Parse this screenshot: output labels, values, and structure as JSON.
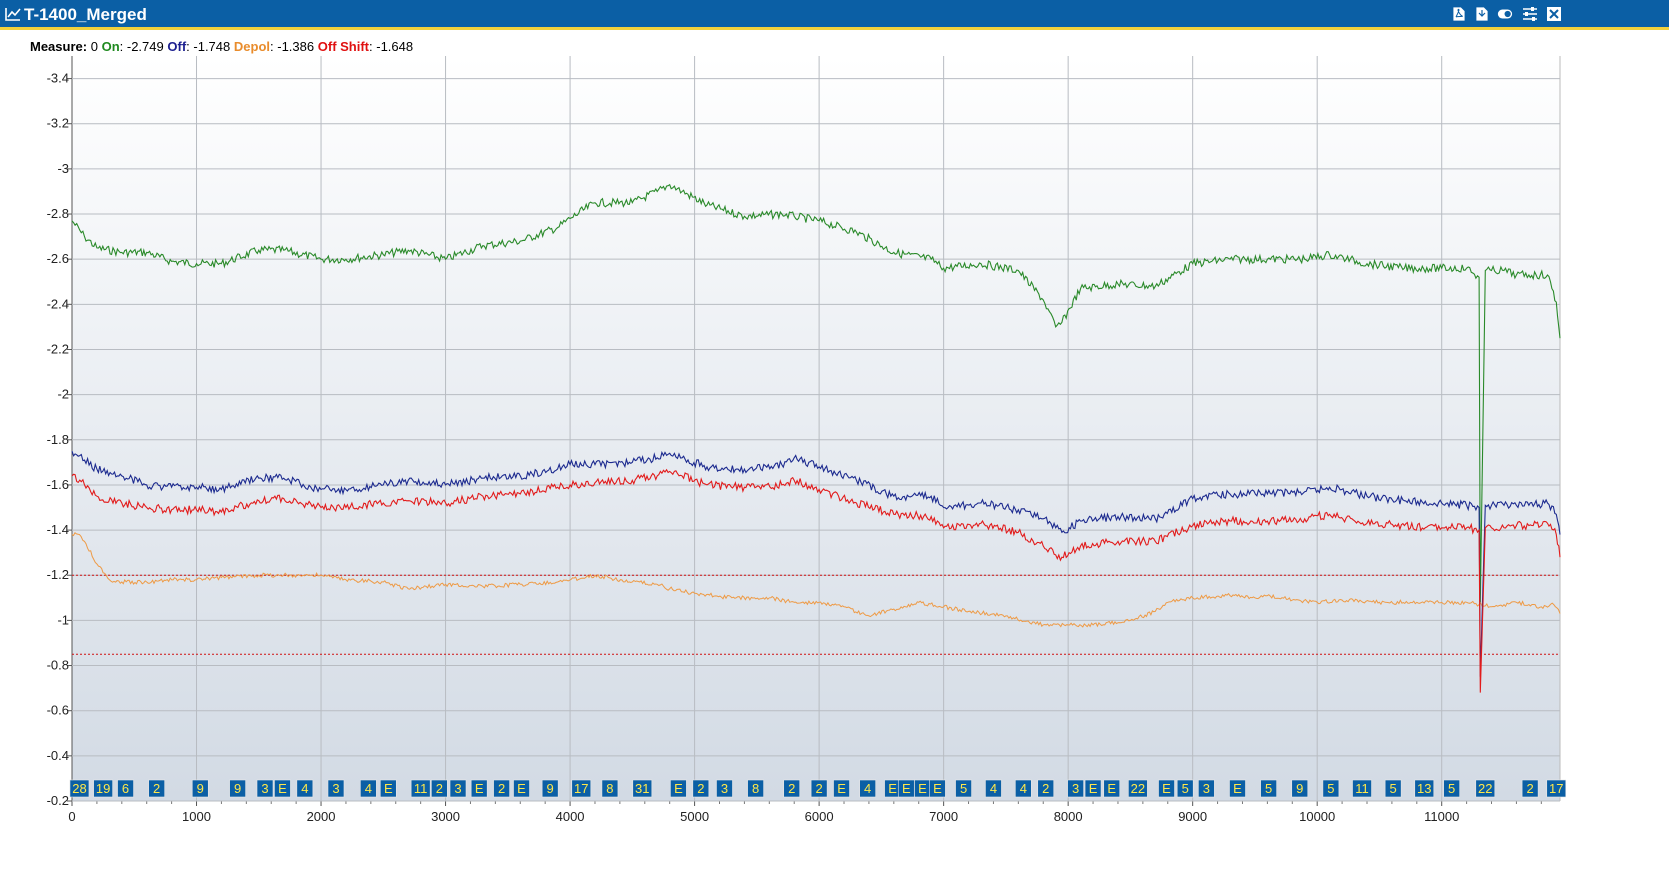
{
  "window": {
    "title": "T-1400_Merged",
    "icons": [
      "line-chart-icon",
      "pdf-export-icon",
      "file-export-icon",
      "toggle-icon",
      "settings-icon",
      "close-icon"
    ]
  },
  "measure": {
    "label": "Measure",
    "index": "0",
    "on_label": "On",
    "on_value": "-2.749",
    "off_label": "Off",
    "off_value": "-1.748",
    "depol_label": "Depol",
    "depol_value": "-1.386",
    "shift_label": "Off Shift",
    "shift_value": "-1.648"
  },
  "colors": {
    "on": "#2a8a2a",
    "off": "#1c2a8f",
    "depol": "#ee9a45",
    "shift": "#e21b1b",
    "titlebar": "#0b5fa5",
    "accent": "#f2d13c",
    "marker": "#0b5fa5"
  },
  "chart_data": {
    "type": "line",
    "x_ticks": [
      "0",
      "1000",
      "2000",
      "3000",
      "4000",
      "5000",
      "6000",
      "7000",
      "8000",
      "9000",
      "10000",
      "11000"
    ],
    "y_ticks": [
      "-0.2",
      "-0.4",
      "-0.6",
      "-0.8",
      "-1",
      "-1.2",
      "-1.4",
      "-1.6",
      "-1.8",
      "-2",
      "-2.2",
      "-2.4",
      "-2.6",
      "-2.8",
      "-3",
      "-3.2",
      "-3.4"
    ],
    "xlim": [
      0,
      11950
    ],
    "ylim": [
      -0.2,
      -3.5
    ],
    "y_inverted": true,
    "grid": true,
    "thresholds": [
      -1.2,
      -0.85
    ],
    "series": [
      {
        "name": "On",
        "key": "on",
        "x": [
          0,
          100,
          200,
          400,
          600,
          800,
          1000,
          1200,
          1500,
          1700,
          2000,
          2200,
          2500,
          2700,
          3000,
          3300,
          3600,
          3900,
          4000,
          4200,
          4500,
          4700,
          4800,
          4900,
          5100,
          5400,
          5700,
          5800,
          6000,
          6300,
          6600,
          6900,
          7000,
          7300,
          7600,
          7800,
          7900,
          7950,
          8100,
          8400,
          8700,
          9000,
          9300,
          9600,
          9900,
          10100,
          10400,
          10700,
          11000,
          11200,
          11300,
          11310,
          11350,
          11400,
          11500,
          11600,
          11700,
          11850,
          11920,
          11950
        ],
        "y": [
          -2.77,
          -2.7,
          -2.65,
          -2.63,
          -2.63,
          -2.59,
          -2.58,
          -2.58,
          -2.64,
          -2.64,
          -2.6,
          -2.6,
          -2.62,
          -2.64,
          -2.6,
          -2.66,
          -2.68,
          -2.74,
          -2.78,
          -2.85,
          -2.85,
          -2.9,
          -2.93,
          -2.9,
          -2.84,
          -2.79,
          -2.8,
          -2.79,
          -2.77,
          -2.72,
          -2.63,
          -2.6,
          -2.56,
          -2.58,
          -2.55,
          -2.42,
          -2.3,
          -2.32,
          -2.47,
          -2.49,
          -2.48,
          -2.58,
          -2.6,
          -2.6,
          -2.6,
          -2.62,
          -2.58,
          -2.56,
          -2.56,
          -2.56,
          -2.52,
          -1.08,
          -2.55,
          -2.55,
          -2.55,
          -2.53,
          -2.53,
          -2.53,
          -2.41,
          -2.25
        ]
      },
      {
        "name": "Off",
        "key": "off",
        "x": [
          0,
          100,
          200,
          400,
          600,
          800,
          1000,
          1200,
          1500,
          1700,
          2000,
          2200,
          2500,
          2700,
          3000,
          3300,
          3600,
          3900,
          4000,
          4200,
          4500,
          4700,
          4800,
          4900,
          5100,
          5400,
          5700,
          5800,
          6000,
          6300,
          6600,
          6900,
          7000,
          7300,
          7600,
          7800,
          7900,
          7950,
          8100,
          8400,
          8700,
          9000,
          9300,
          9600,
          9900,
          10100,
          10400,
          10700,
          11000,
          11200,
          11300,
          11310,
          11350,
          11400,
          11500,
          11600,
          11700,
          11850,
          11920,
          11950
        ],
        "y": [
          -1.75,
          -1.71,
          -1.67,
          -1.64,
          -1.6,
          -1.59,
          -1.59,
          -1.58,
          -1.63,
          -1.63,
          -1.58,
          -1.58,
          -1.6,
          -1.62,
          -1.6,
          -1.63,
          -1.64,
          -1.67,
          -1.69,
          -1.69,
          -1.7,
          -1.72,
          -1.74,
          -1.72,
          -1.68,
          -1.67,
          -1.69,
          -1.72,
          -1.68,
          -1.62,
          -1.55,
          -1.55,
          -1.5,
          -1.52,
          -1.49,
          -1.45,
          -1.41,
          -1.39,
          -1.44,
          -1.46,
          -1.45,
          -1.54,
          -1.56,
          -1.56,
          -1.57,
          -1.59,
          -1.55,
          -1.53,
          -1.52,
          -1.51,
          -1.5,
          -0.75,
          -1.51,
          -1.51,
          -1.51,
          -1.51,
          -1.51,
          -1.52,
          -1.47,
          -1.38
        ]
      },
      {
        "name": "Off Shift",
        "key": "shift",
        "x": [
          0,
          100,
          200,
          400,
          600,
          800,
          1000,
          1200,
          1500,
          1700,
          2000,
          2200,
          2500,
          2700,
          3000,
          3300,
          3600,
          3900,
          4000,
          4200,
          4500,
          4700,
          4800,
          4900,
          5100,
          5400,
          5700,
          5800,
          6000,
          6300,
          6600,
          6900,
          7000,
          7300,
          7600,
          7800,
          7900,
          7950,
          8100,
          8400,
          8700,
          9000,
          9300,
          9600,
          9900,
          10100,
          10400,
          10700,
          11000,
          11200,
          11300,
          11310,
          11350,
          11400,
          11500,
          11600,
          11700,
          11850,
          11920,
          11950
        ],
        "y": [
          -1.64,
          -1.6,
          -1.55,
          -1.52,
          -1.5,
          -1.49,
          -1.49,
          -1.48,
          -1.53,
          -1.54,
          -1.5,
          -1.5,
          -1.52,
          -1.53,
          -1.52,
          -1.55,
          -1.56,
          -1.59,
          -1.6,
          -1.61,
          -1.62,
          -1.64,
          -1.66,
          -1.64,
          -1.6,
          -1.59,
          -1.6,
          -1.62,
          -1.58,
          -1.52,
          -1.47,
          -1.46,
          -1.41,
          -1.43,
          -1.39,
          -1.33,
          -1.29,
          -1.28,
          -1.33,
          -1.35,
          -1.35,
          -1.42,
          -1.44,
          -1.44,
          -1.45,
          -1.47,
          -1.43,
          -1.42,
          -1.41,
          -1.41,
          -1.4,
          -0.68,
          -1.41,
          -1.41,
          -1.41,
          -1.42,
          -1.42,
          -1.43,
          -1.38,
          -1.28
        ]
      },
      {
        "name": "Depol",
        "key": "depol",
        "x": [
          0,
          60,
          100,
          200,
          300,
          400,
          600,
          800,
          1000,
          1200,
          1500,
          1700,
          2000,
          2200,
          2500,
          2700,
          3000,
          3300,
          3600,
          3900,
          4200,
          4500,
          4700,
          4800,
          5000,
          5300,
          5600,
          5800,
          6000,
          6200,
          6400,
          6600,
          6800,
          7000,
          7200,
          7500,
          7800,
          8000,
          8200,
          8400,
          8500,
          8700,
          8800,
          9000,
          9300,
          9500,
          9600,
          9800,
          10000,
          10200,
          10500,
          10800,
          11000,
          11200,
          11300,
          11400,
          11500,
          11600,
          11700,
          11800,
          11900,
          11950
        ],
        "y": [
          -1.38,
          -1.38,
          -1.35,
          -1.25,
          -1.18,
          -1.17,
          -1.17,
          -1.18,
          -1.18,
          -1.19,
          -1.2,
          -1.2,
          -1.2,
          -1.18,
          -1.17,
          -1.14,
          -1.16,
          -1.15,
          -1.16,
          -1.17,
          -1.2,
          -1.17,
          -1.16,
          -1.14,
          -1.12,
          -1.1,
          -1.1,
          -1.08,
          -1.08,
          -1.06,
          -1.02,
          -1.05,
          -1.08,
          -1.06,
          -1.04,
          -1.02,
          -0.98,
          -0.98,
          -0.98,
          -0.99,
          -1.0,
          -1.04,
          -1.08,
          -1.1,
          -1.11,
          -1.1,
          -1.11,
          -1.09,
          -1.08,
          -1.09,
          -1.08,
          -1.08,
          -1.08,
          -1.08,
          -1.07,
          -1.06,
          -1.07,
          -1.08,
          -1.07,
          -1.06,
          -1.07,
          -1.03
        ]
      }
    ],
    "markers": [
      {
        "x": 60,
        "label": "28"
      },
      {
        "x": 250,
        "label": "19"
      },
      {
        "x": 430,
        "label": "6"
      },
      {
        "x": 680,
        "label": "2"
      },
      {
        "x": 1030,
        "label": "9"
      },
      {
        "x": 1330,
        "label": "9"
      },
      {
        "x": 1550,
        "label": "3"
      },
      {
        "x": 1690,
        "label": "E"
      },
      {
        "x": 1870,
        "label": "4"
      },
      {
        "x": 2120,
        "label": "3"
      },
      {
        "x": 2380,
        "label": "4"
      },
      {
        "x": 2540,
        "label": "E"
      },
      {
        "x": 2800,
        "label": "11"
      },
      {
        "x": 2950,
        "label": "2"
      },
      {
        "x": 3100,
        "label": "3"
      },
      {
        "x": 3270,
        "label": "E"
      },
      {
        "x": 3450,
        "label": "2"
      },
      {
        "x": 3610,
        "label": "E"
      },
      {
        "x": 3840,
        "label": "9"
      },
      {
        "x": 4090,
        "label": "17"
      },
      {
        "x": 4320,
        "label": "8"
      },
      {
        "x": 4580,
        "label": "31"
      },
      {
        "x": 4870,
        "label": "E"
      },
      {
        "x": 5050,
        "label": "2"
      },
      {
        "x": 5240,
        "label": "3"
      },
      {
        "x": 5490,
        "label": "8"
      },
      {
        "x": 5780,
        "label": "2"
      },
      {
        "x": 6000,
        "label": "2"
      },
      {
        "x": 6180,
        "label": "E"
      },
      {
        "x": 6390,
        "label": "4"
      },
      {
        "x": 6590,
        "label": "E"
      },
      {
        "x": 6700,
        "label": "E"
      },
      {
        "x": 6830,
        "label": "E"
      },
      {
        "x": 6950,
        "label": "E"
      },
      {
        "x": 7160,
        "label": "5"
      },
      {
        "x": 7400,
        "label": "4"
      },
      {
        "x": 7640,
        "label": "4"
      },
      {
        "x": 7820,
        "label": "2"
      },
      {
        "x": 8060,
        "label": "3"
      },
      {
        "x": 8200,
        "label": "E"
      },
      {
        "x": 8350,
        "label": "E"
      },
      {
        "x": 8560,
        "label": "22"
      },
      {
        "x": 8790,
        "label": "E"
      },
      {
        "x": 8940,
        "label": "5"
      },
      {
        "x": 9110,
        "label": "3"
      },
      {
        "x": 9360,
        "label": "E"
      },
      {
        "x": 9610,
        "label": "5"
      },
      {
        "x": 9860,
        "label": "9"
      },
      {
        "x": 10110,
        "label": "5"
      },
      {
        "x": 10360,
        "label": "11"
      },
      {
        "x": 10610,
        "label": "5"
      },
      {
        "x": 10860,
        "label": "13"
      },
      {
        "x": 11080,
        "label": "5"
      },
      {
        "x": 11350,
        "label": "22"
      },
      {
        "x": 11710,
        "label": "2"
      },
      {
        "x": 11920,
        "label": "17"
      }
    ]
  }
}
